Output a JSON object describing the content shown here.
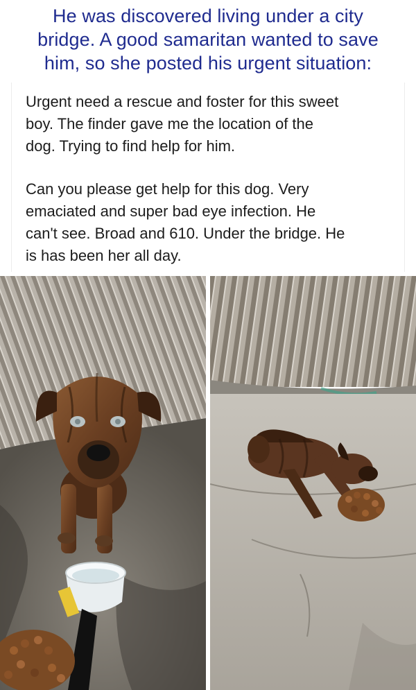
{
  "headline": {
    "lines": [
      "He was discovered living under a city",
      "bridge. A good samaritan wanted to save",
      "him, so she posted his urgent situation:"
    ]
  },
  "post": {
    "paragraph1": [
      "Urgent need a rescue and foster for this sweet",
      "boy. The finder gave me the location of the",
      "dog.   Trying to find help for him."
    ],
    "paragraph2": [
      "Can you please get help for this dog. Very",
      "emaciated and super bad eye infection.  He",
      "can't see. Broad and 610. Under the bridge.  He",
      "is has been her all day."
    ]
  },
  "colors": {
    "headline": "#1f2b8f",
    "post_text": "#1c1c1c"
  }
}
